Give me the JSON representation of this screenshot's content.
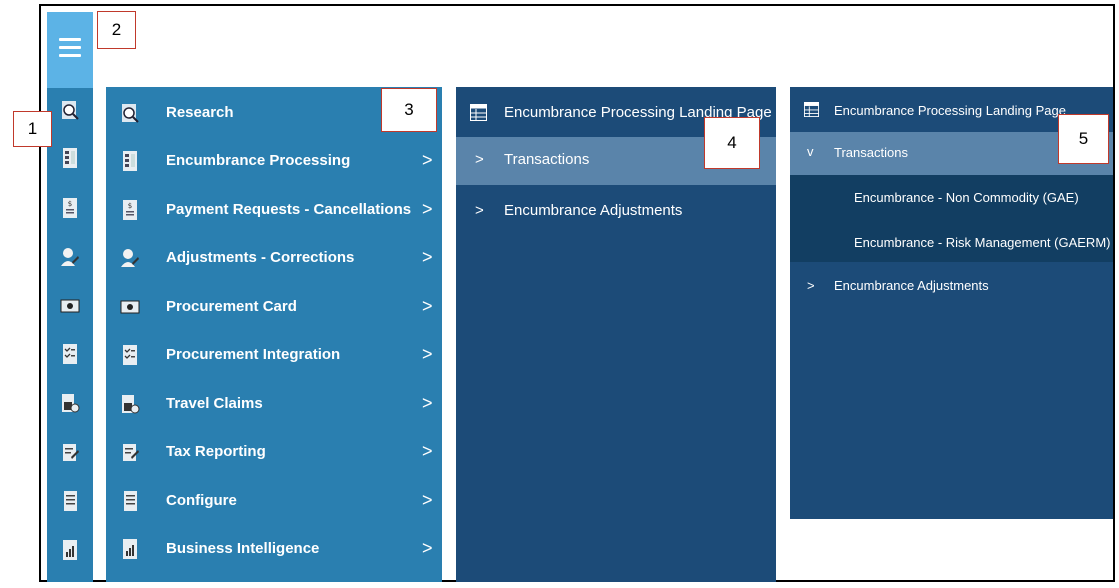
{
  "callouts": [
    "1",
    "2",
    "3",
    "4",
    "5"
  ],
  "rail": {
    "icons": [
      "research-icon",
      "encumbrance-icon",
      "payment-icon",
      "adjustments-icon",
      "procurement-card-icon",
      "procurement-integration-icon",
      "travel-claims-icon",
      "tax-reporting-icon",
      "configure-icon",
      "business-intelligence-icon"
    ]
  },
  "menu": {
    "items": [
      {
        "label": "Research",
        "icon": "research-icon",
        "chevron": ""
      },
      {
        "label": "Encumbrance Processing",
        "icon": "encumbrance-icon",
        "chevron": ">"
      },
      {
        "label": "Payment Requests - Cancellations",
        "icon": "payment-icon",
        "chevron": ">"
      },
      {
        "label": "Adjustments - Corrections",
        "icon": "adjustments-icon",
        "chevron": ">"
      },
      {
        "label": "Procurement Card",
        "icon": "procurement-card-icon",
        "chevron": ">"
      },
      {
        "label": "Procurement Integration",
        "icon": "procurement-integration-icon",
        "chevron": ">"
      },
      {
        "label": "Travel Claims",
        "icon": "travel-claims-icon",
        "chevron": ">"
      },
      {
        "label": "Tax Reporting",
        "icon": "tax-reporting-icon",
        "chevron": ">"
      },
      {
        "label": "Configure",
        "icon": "configure-icon",
        "chevron": ">"
      },
      {
        "label": "Business Intelligence",
        "icon": "business-intelligence-icon",
        "chevron": ">"
      }
    ]
  },
  "panel3": {
    "header": "Encumbrance Processing Landing Page",
    "chevron": ">",
    "items": [
      "Transactions",
      "Encumbrance Adjustments"
    ]
  },
  "panel4": {
    "header": "Encumbrance Processing Landing Page",
    "expanded_chevron": "v",
    "collapsed_chevron": ">",
    "transactions": "Transactions",
    "sub_items": [
      "Encumbrance - Non Commodity (GAE)",
      "Encumbrance - Risk Management (GAERM)"
    ],
    "adjustments": "Encumbrance Adjustments"
  },
  "colors": {
    "rail": "#2a7fb0",
    "hamburger": "#5cb3e6",
    "panel_dark": "#1c4b78",
    "selected": "#5a84aa",
    "sub_bg": "#123e62"
  }
}
